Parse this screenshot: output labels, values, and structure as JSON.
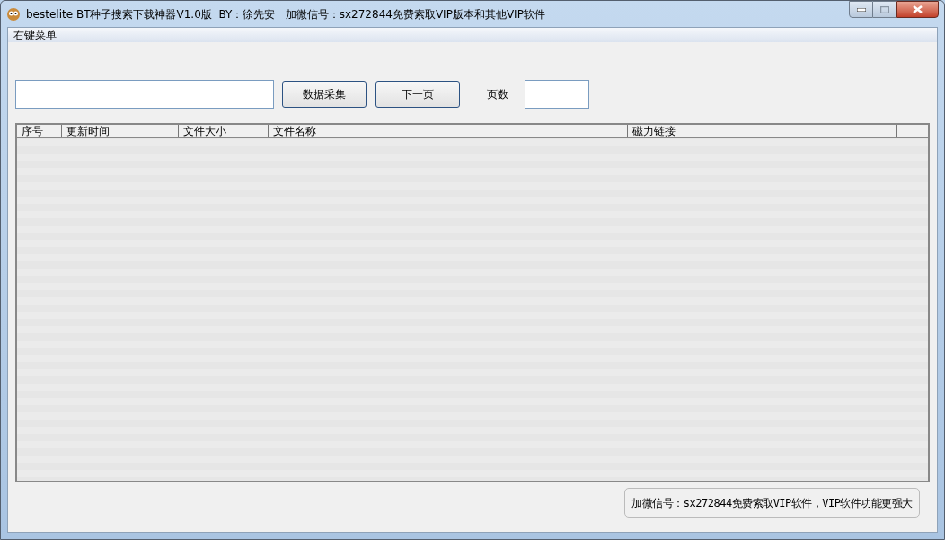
{
  "window": {
    "title": "bestelite BT种子搜索下载神器V1.0版  BY：徐先安   加微信号：sx272844免费索取VIP版本和其他VIP软件"
  },
  "menu": [
    "右键菜单"
  ],
  "toolbar": {
    "collect_button": "数据采集",
    "next_button": "下一页",
    "page_label": "页数"
  },
  "table": {
    "columns": [
      "序号",
      "更新时间",
      "文件大小",
      "文件名称",
      "磁力链接"
    ]
  },
  "notice": "加微信号：sx272844免费索取VIP软件，VIP软件功能更强大"
}
